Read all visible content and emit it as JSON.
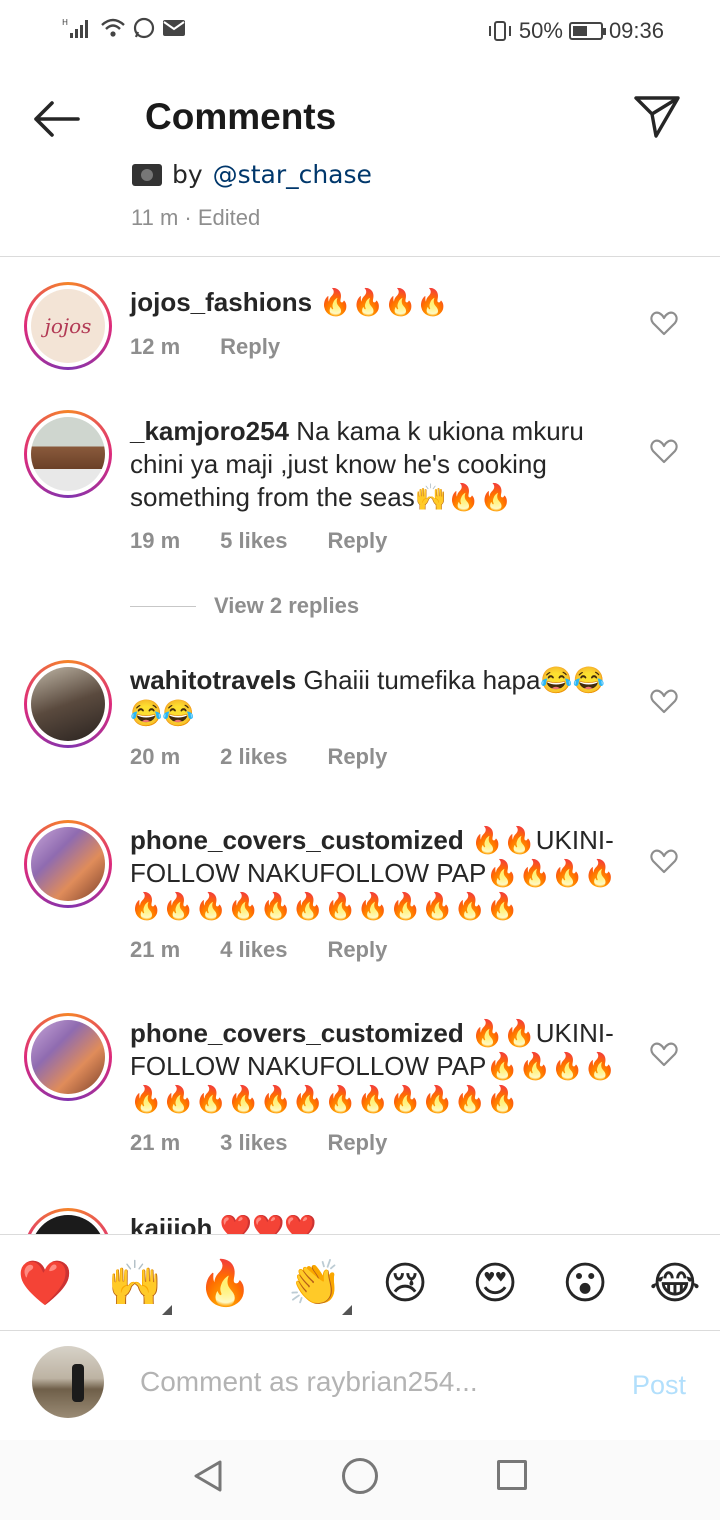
{
  "status_bar": {
    "battery": "50%",
    "time": "09:36"
  },
  "header": {
    "title": "Comments"
  },
  "caption": {
    "by": "by",
    "mention": "@star_chase",
    "meta": "11 m · Edited"
  },
  "comments": [
    {
      "user": "jojos_fashions",
      "text": "🔥🔥🔥🔥",
      "time": "12 m",
      "likes": "",
      "reply": "Reply",
      "avatar_text": "jojos"
    },
    {
      "user": "_kamjoro254",
      "text": "Na kama k ukiona mkuru chini ya maji ,just know he's cooking something from the seas🙌🔥🔥",
      "time": "19 m",
      "likes": "5 likes",
      "reply": "Reply"
    },
    {
      "user": "wahitotravels",
      "text": "Ghaiii tumefika hapa😂😂😂😂",
      "time": "20 m",
      "likes": "2 likes",
      "reply": "Reply"
    },
    {
      "user": "phone_covers_customized",
      "text": "🔥🔥UKINI-FOLLOW NAKUFOLLOW PAP🔥🔥🔥🔥🔥🔥🔥🔥🔥🔥🔥🔥🔥🔥🔥🔥",
      "time": "21 m",
      "likes": "4 likes",
      "reply": "Reply"
    },
    {
      "user": "phone_covers_customized",
      "text": "🔥🔥UKINI-FOLLOW NAKUFOLLOW PAP🔥🔥🔥🔥🔥🔥🔥🔥🔥🔥🔥🔥🔥🔥🔥🔥",
      "time": "21 m",
      "likes": "3 likes",
      "reply": "Reply"
    },
    {
      "user": "kaiiioh",
      "text": "❤️❤️❤️"
    }
  ],
  "view_replies": "View 2 replies",
  "emoji_bar": [
    "❤️",
    "🙌",
    "🔥",
    "👏",
    "😢",
    "😍",
    "😮",
    "😂"
  ],
  "compose": {
    "placeholder": "Comment as raybrian254...",
    "post_label": "Post"
  },
  "colors": {
    "accent_link": "#00376b",
    "post_disabled": "#b2dffc",
    "meta_gray": "#8e8e8e"
  }
}
